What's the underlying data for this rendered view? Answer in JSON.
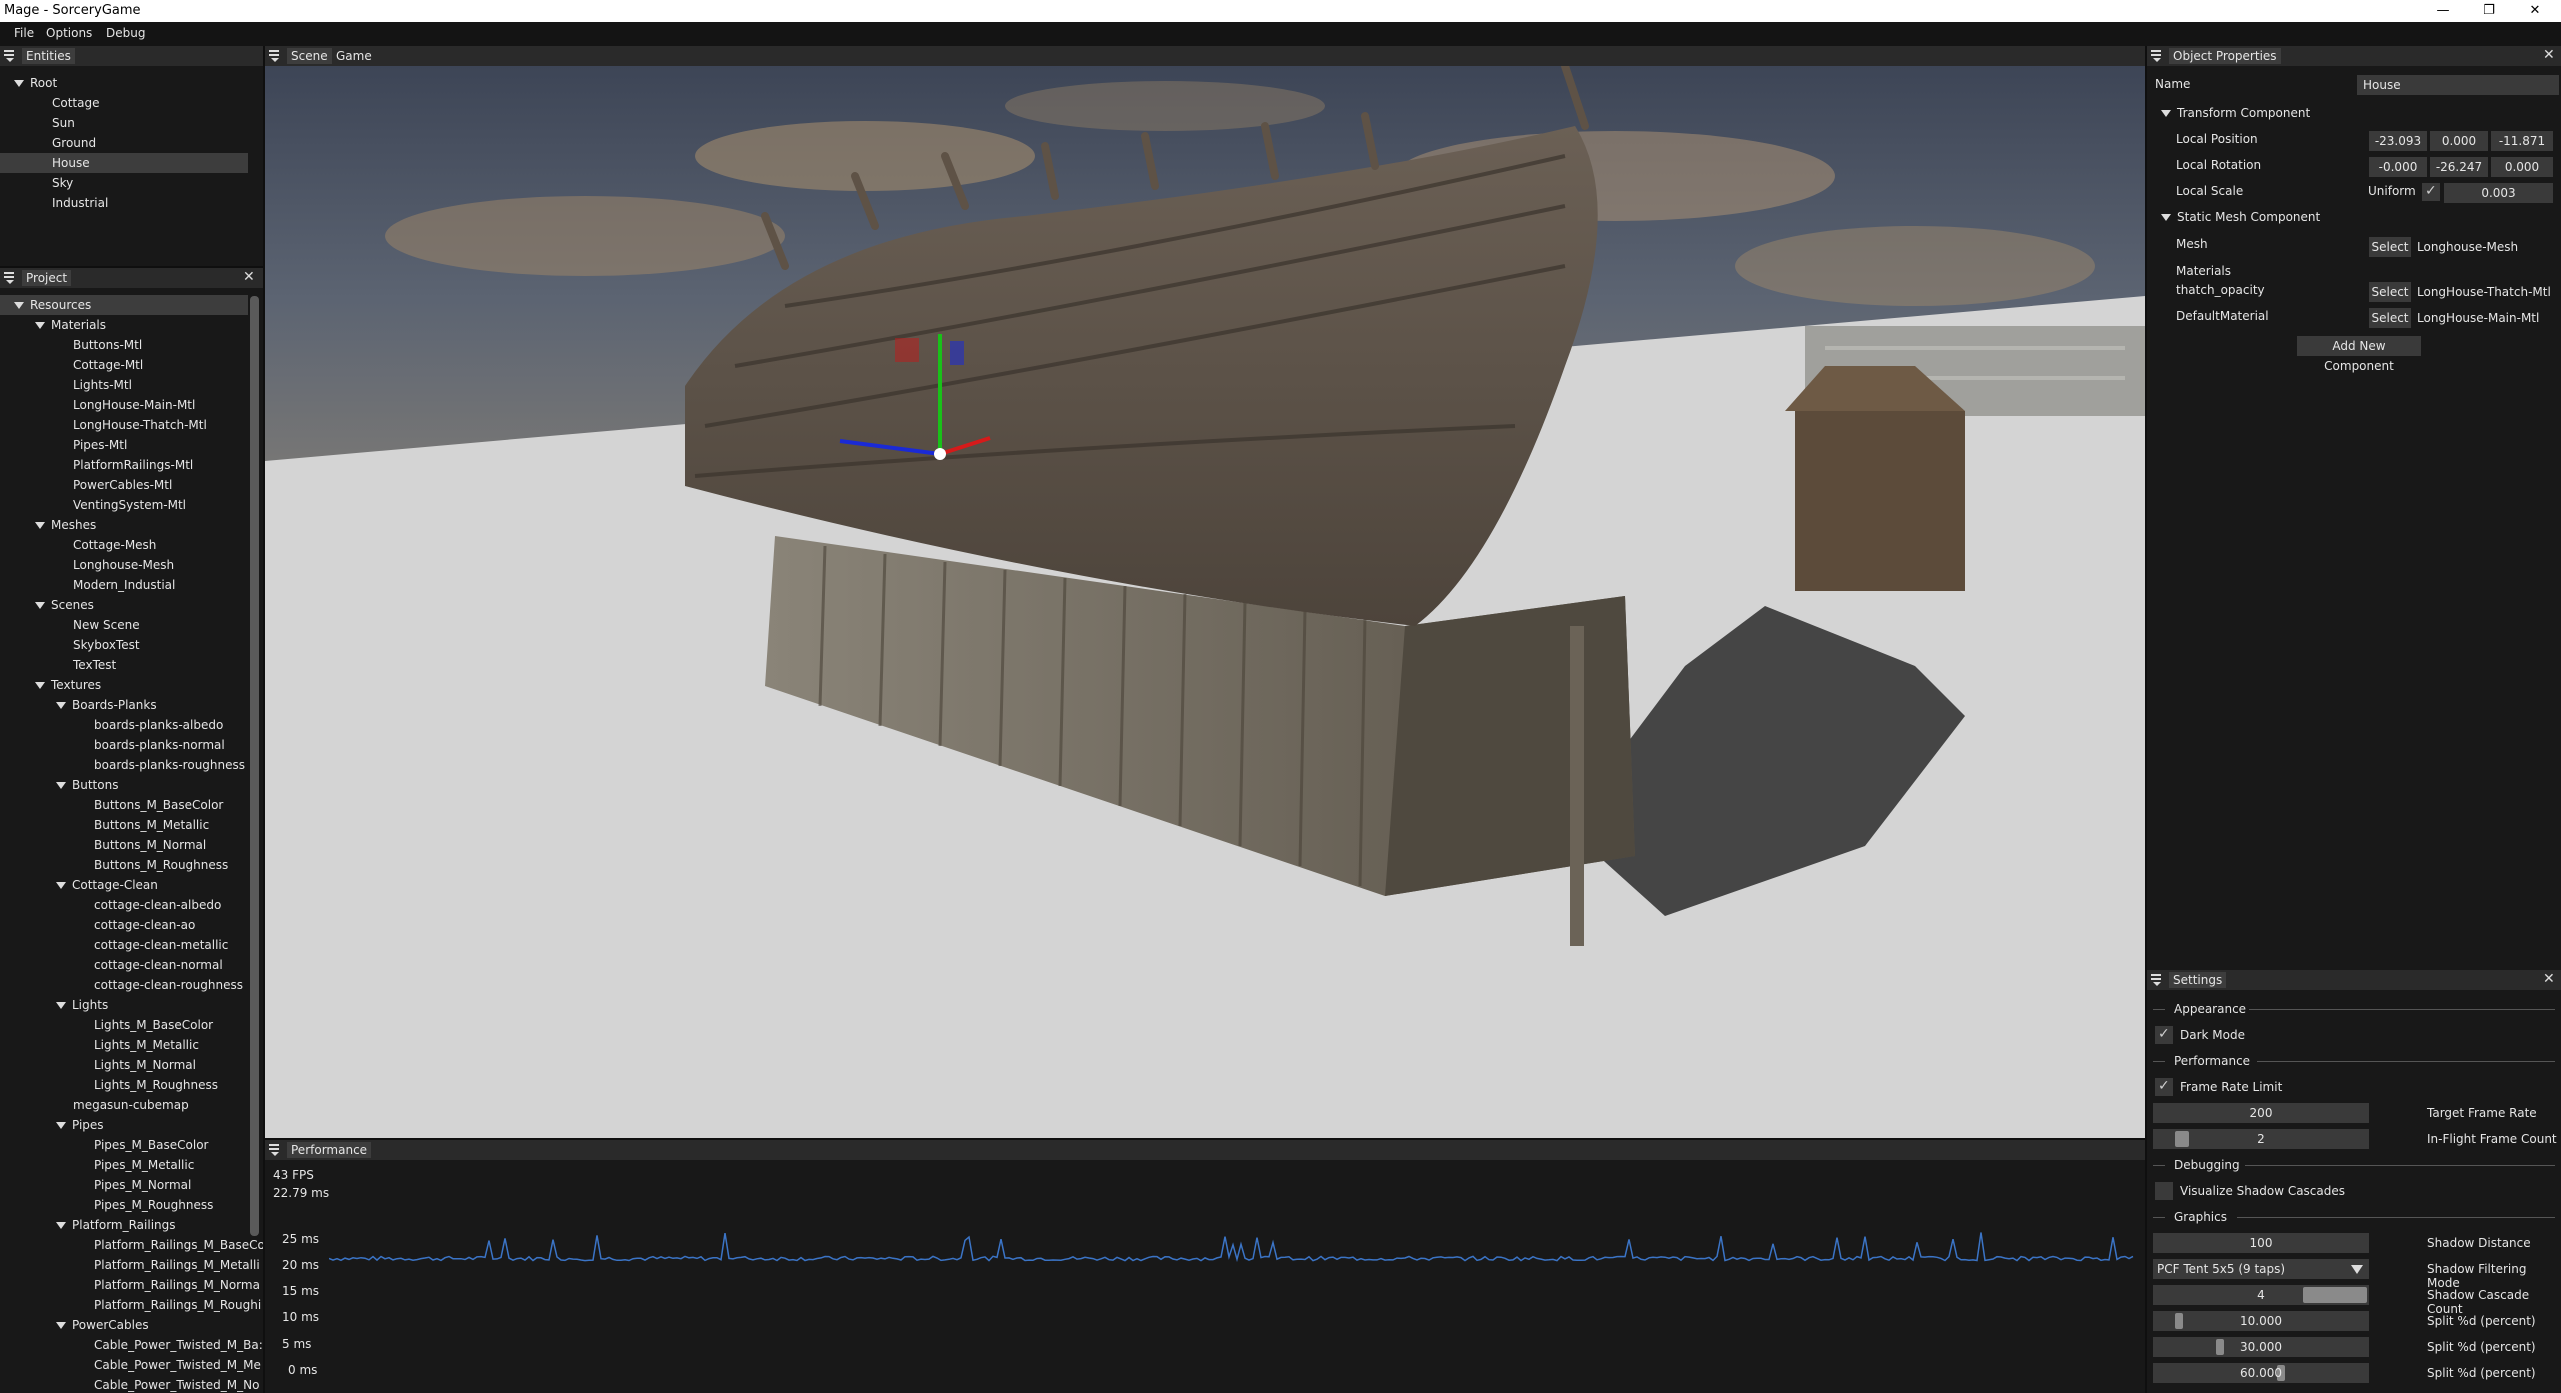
{
  "window": {
    "title": "Mage - SorceryGame",
    "minimize": "—",
    "maximize": "❐",
    "close": "✕"
  },
  "menu": [
    "File",
    "Options",
    "Debug"
  ],
  "entities": {
    "tab": "Entities",
    "items": [
      {
        "label": "Root",
        "depth": 0,
        "expanded": true
      },
      {
        "label": "Cottage",
        "depth": 1
      },
      {
        "label": "Sun",
        "depth": 1
      },
      {
        "label": "Ground",
        "depth": 1
      },
      {
        "label": "House",
        "depth": 1,
        "selected": true
      },
      {
        "label": "Sky",
        "depth": 1
      },
      {
        "label": "Industrial",
        "depth": 1
      }
    ]
  },
  "project": {
    "tab": "Project",
    "items": [
      {
        "label": "Resources",
        "depth": 0,
        "expanded": true,
        "selected": true
      },
      {
        "label": "Materials",
        "depth": 1,
        "expanded": true
      },
      {
        "label": "Buttons-Mtl",
        "depth": 2
      },
      {
        "label": "Cottage-Mtl",
        "depth": 2
      },
      {
        "label": "Lights-Mtl",
        "depth": 2
      },
      {
        "label": "LongHouse-Main-Mtl",
        "depth": 2
      },
      {
        "label": "LongHouse-Thatch-Mtl",
        "depth": 2
      },
      {
        "label": "Pipes-Mtl",
        "depth": 2
      },
      {
        "label": "PlatformRailings-Mtl",
        "depth": 2
      },
      {
        "label": "PowerCables-Mtl",
        "depth": 2
      },
      {
        "label": "VentingSystem-Mtl",
        "depth": 2
      },
      {
        "label": "Meshes",
        "depth": 1,
        "expanded": true
      },
      {
        "label": "Cottage-Mesh",
        "depth": 2
      },
      {
        "label": "Longhouse-Mesh",
        "depth": 2
      },
      {
        "label": "Modern_Industial",
        "depth": 2
      },
      {
        "label": "Scenes",
        "depth": 1,
        "expanded": true
      },
      {
        "label": "New Scene",
        "depth": 2
      },
      {
        "label": "SkyboxTest",
        "depth": 2
      },
      {
        "label": "TexTest",
        "depth": 2
      },
      {
        "label": "Textures",
        "depth": 1,
        "expanded": true
      },
      {
        "label": "Boards-Planks",
        "depth": 2,
        "expanded": true
      },
      {
        "label": "boards-planks-albedo",
        "depth": 3
      },
      {
        "label": "boards-planks-normal",
        "depth": 3
      },
      {
        "label": "boards-planks-roughness",
        "depth": 3
      },
      {
        "label": "Buttons",
        "depth": 2,
        "expanded": true
      },
      {
        "label": "Buttons_M_BaseColor",
        "depth": 3
      },
      {
        "label": "Buttons_M_Metallic",
        "depth": 3
      },
      {
        "label": "Buttons_M_Normal",
        "depth": 3
      },
      {
        "label": "Buttons_M_Roughness",
        "depth": 3
      },
      {
        "label": "Cottage-Clean",
        "depth": 2,
        "expanded": true
      },
      {
        "label": "cottage-clean-albedo",
        "depth": 3
      },
      {
        "label": "cottage-clean-ao",
        "depth": 3
      },
      {
        "label": "cottage-clean-metallic",
        "depth": 3
      },
      {
        "label": "cottage-clean-normal",
        "depth": 3
      },
      {
        "label": "cottage-clean-roughness",
        "depth": 3
      },
      {
        "label": "Lights",
        "depth": 2,
        "expanded": true
      },
      {
        "label": "Lights_M_BaseColor",
        "depth": 3
      },
      {
        "label": "Lights_M_Metallic",
        "depth": 3
      },
      {
        "label": "Lights_M_Normal",
        "depth": 3
      },
      {
        "label": "Lights_M_Roughness",
        "depth": 3
      },
      {
        "label": "megasun-cubemap",
        "depth": 2
      },
      {
        "label": "Pipes",
        "depth": 2,
        "expanded": true
      },
      {
        "label": "Pipes_M_BaseColor",
        "depth": 3
      },
      {
        "label": "Pipes_M_Metallic",
        "depth": 3
      },
      {
        "label": "Pipes_M_Normal",
        "depth": 3
      },
      {
        "label": "Pipes_M_Roughness",
        "depth": 3
      },
      {
        "label": "Platform_Railings",
        "depth": 2,
        "expanded": true
      },
      {
        "label": "Platform_Railings_M_BaseCo",
        "depth": 3
      },
      {
        "label": "Platform_Railings_M_Metalli",
        "depth": 3
      },
      {
        "label": "Platform_Railings_M_Norma",
        "depth": 3
      },
      {
        "label": "Platform_Railings_M_Roughi",
        "depth": 3
      },
      {
        "label": "PowerCables",
        "depth": 2,
        "expanded": true
      },
      {
        "label": "Cable_Power_Twisted_M_Ba:",
        "depth": 3
      },
      {
        "label": "Cable_Power_Twisted_M_Me",
        "depth": 3
      },
      {
        "label": "Cable_Power_Twisted_M_No",
        "depth": 3
      }
    ]
  },
  "viewport": {
    "tabs": [
      "Scene",
      "Game"
    ],
    "active": "Scene"
  },
  "performance": {
    "tab": "Performance",
    "fps": "43 FPS",
    "frame_ms": "22.79 ms",
    "axis": [
      "25 ms",
      "20 ms",
      "15 ms",
      "10 ms",
      "5 ms",
      "0 ms"
    ],
    "line_color": "#3b74c6"
  },
  "properties": {
    "tab": "Object Properties",
    "name_label": "Name",
    "name_value": "House",
    "transform": {
      "header": "Transform Component",
      "position_label": "Local Position",
      "position": [
        "-23.093",
        "0.000",
        "-11.871"
      ],
      "rotation_label": "Local Rotation",
      "rotation": [
        "-0.000",
        "-26.247",
        "0.000"
      ],
      "scale_label": "Local Scale",
      "uniform_label": "Uniform",
      "uniform_checked": true,
      "scale": "0.003"
    },
    "mesh": {
      "header": "Static Mesh Component",
      "mesh_label": "Mesh",
      "select_label": "Select",
      "mesh_value": "Longhouse-Mesh",
      "materials_label": "Materials",
      "materials": [
        {
          "slot": "thatch_opacity",
          "value": "LongHouse-Thatch-Mtl"
        },
        {
          "slot": "DefaultMaterial",
          "value": "LongHouse-Main-Mtl"
        }
      ]
    },
    "add_component": "Add New Component"
  },
  "settings": {
    "tab": "Settings",
    "appearance": "Appearance",
    "dark_mode": "Dark Mode",
    "dark_mode_on": true,
    "performance": "Performance",
    "frame_rate_limit": "Frame Rate Limit",
    "frame_rate_limit_on": true,
    "target_frame_rate": {
      "value": "200",
      "label": "Target Frame Rate"
    },
    "in_flight": {
      "value": "2",
      "label": "In-Flight Frame Count",
      "level": 0.1
    },
    "debugging": "Debugging",
    "visualize_cascades": "Visualize Shadow Cascades",
    "visualize_cascades_on": false,
    "graphics": "Graphics",
    "shadow_distance": {
      "value": "100",
      "label": "Shadow Distance"
    },
    "shadow_filtering": {
      "value": "PCF Tent 5x5 (9 taps)",
      "label": "Shadow Filtering Mode"
    },
    "cascade_count": {
      "value": "4",
      "label": "Shadow Cascade Count",
      "level": 1.0
    },
    "splits": [
      {
        "value": "10.000",
        "label": "Split %d (percent)",
        "level": 0.1
      },
      {
        "value": "30.000",
        "label": "Split %d (percent)",
        "level": 0.3
      },
      {
        "value": "60.000",
        "label": "Split %d (percent)",
        "level": 0.6
      }
    ]
  }
}
